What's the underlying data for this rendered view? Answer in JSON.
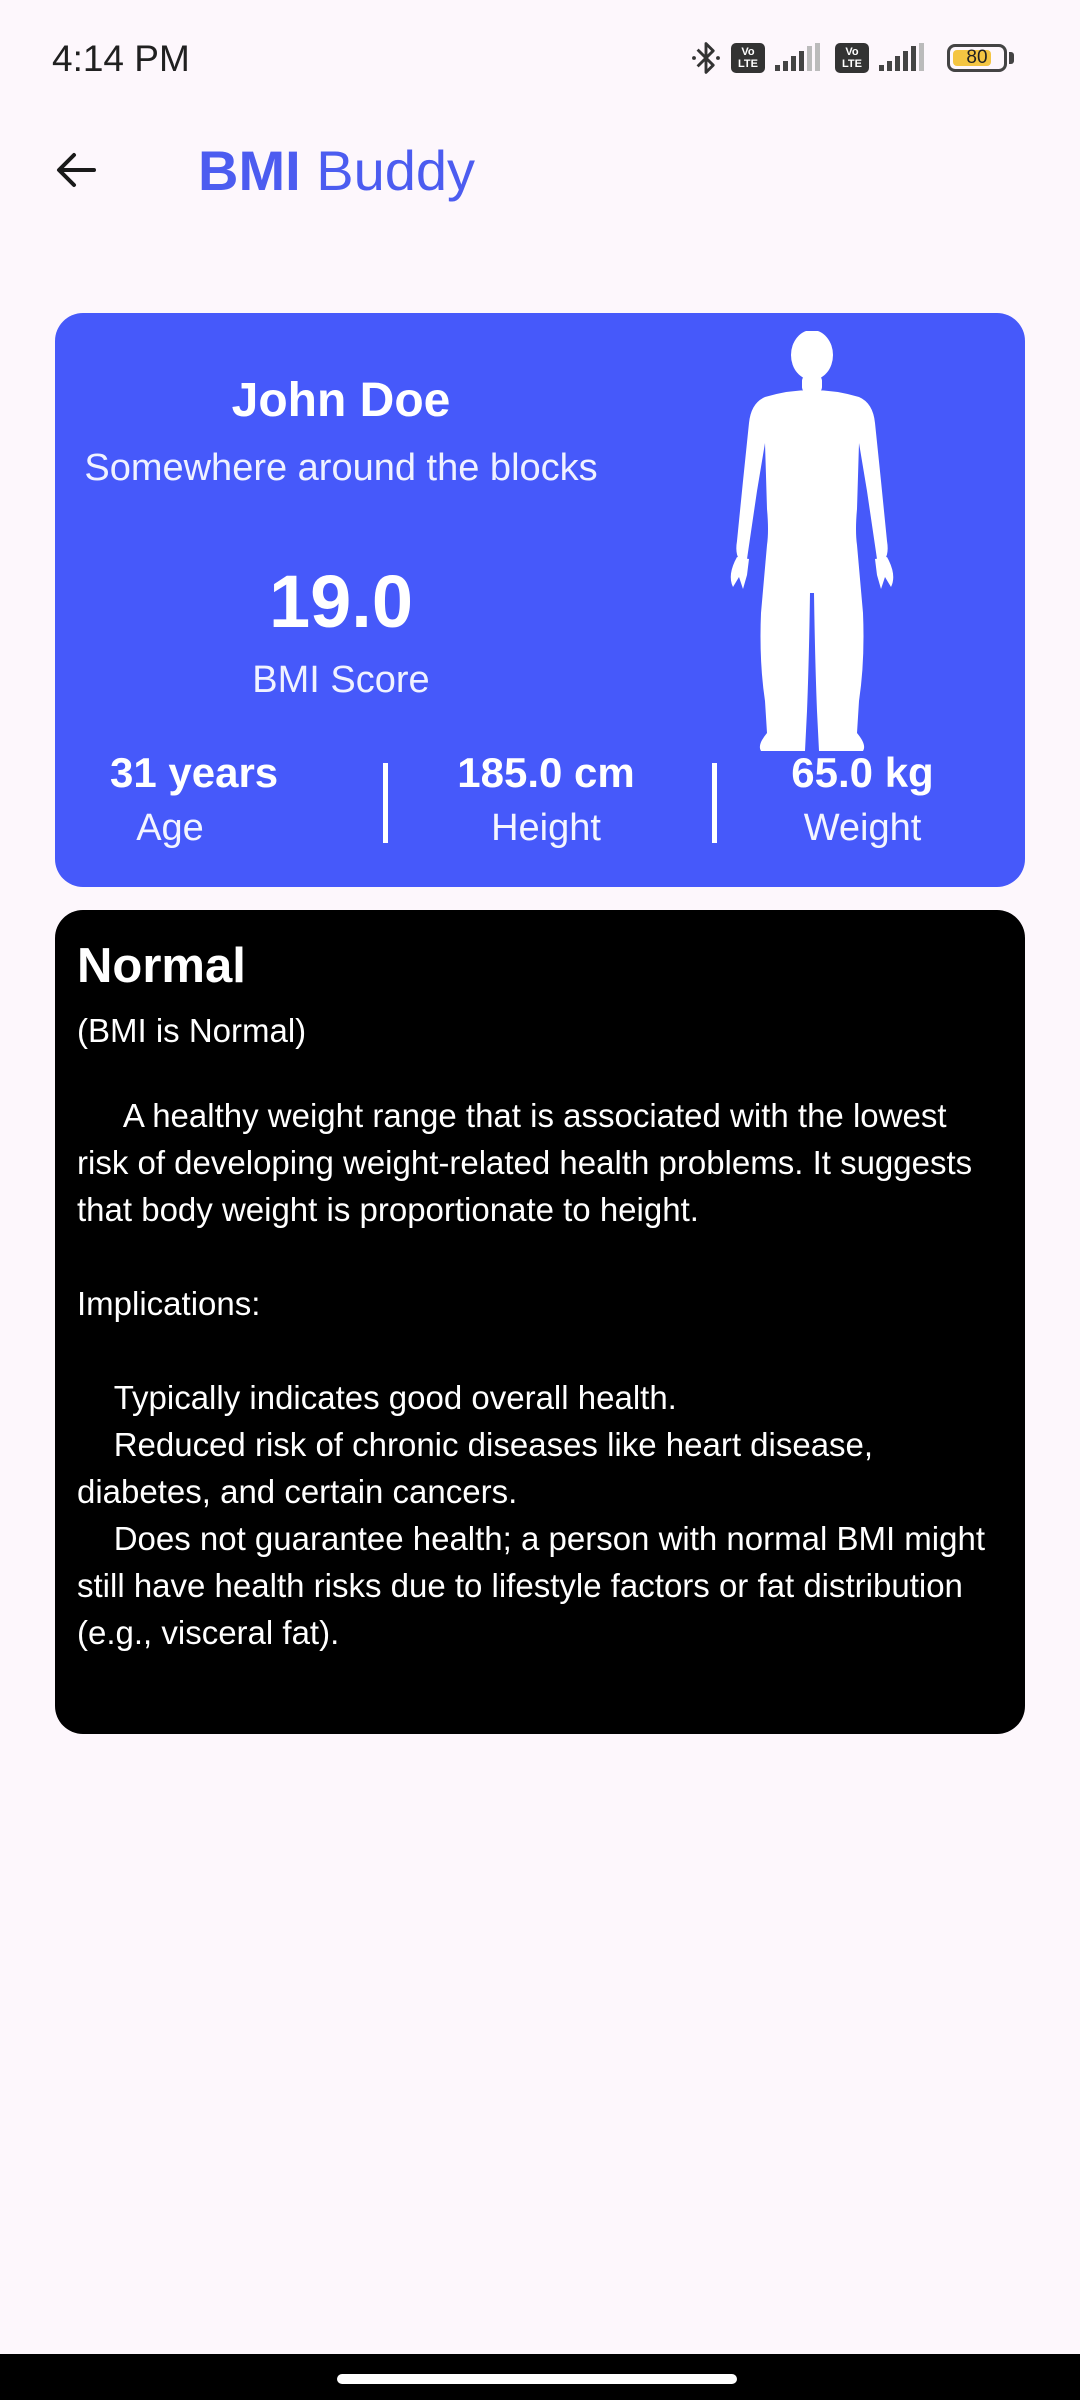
{
  "status_bar": {
    "time": "4:14 PM",
    "lte_1": "Vo LTE",
    "lte_2": "Vo LTE",
    "battery_level": "80",
    "battery_fraction": 0.8
  },
  "app_bar": {
    "title_bold": "BMI",
    "title_rest": " Buddy"
  },
  "profile": {
    "name": "John Doe",
    "address": "Somewhere around the blocks",
    "bmi_value": "19.0",
    "bmi_label": "BMI Score",
    "stats": {
      "age_value": "31 years",
      "age_label": "Age",
      "height_value": "185.0 cm",
      "height_label": "Height",
      "weight_value": "65.0 kg",
      "weight_label": "Weight"
    },
    "accent_color": "#4659fa"
  },
  "category": {
    "title": "Normal",
    "subtitle": "(BMI is Normal)",
    "description": "     A healthy weight range that is associated with the lowest risk of developing weight-related health problems. It suggests that body weight is proportionate to height.\n\nImplications:\n\n    Typically indicates good overall health.\n    Reduced risk of chronic diseases like heart disease, diabetes, and certain cancers.\n    Does not guarantee health; a person with normal BMI might still have health risks due to lifestyle factors or fat distribution (e.g., visceral fat)."
  },
  "icons": {
    "back": "arrow-back-icon",
    "bluetooth": "bluetooth-icon",
    "signal": "cellular-signal-icon",
    "battery": "battery-icon",
    "body": "human-body-icon"
  }
}
